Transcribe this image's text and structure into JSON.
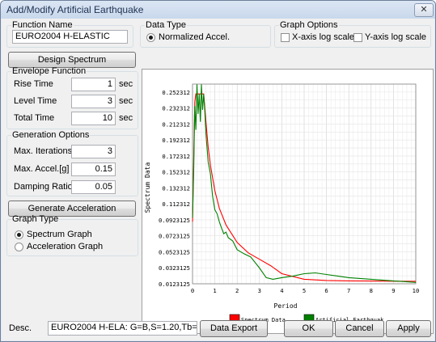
{
  "window": {
    "title": "Add/Modify Artificial Earthquake",
    "close_glyph": "✕"
  },
  "function_name": {
    "label": "Function Name",
    "value": "EURO2004 H-ELASTIC"
  },
  "data_type": {
    "label": "Data Type",
    "option": "Normalized Accel."
  },
  "graph_options": {
    "label": "Graph Options",
    "x_log": "X-axis log scale",
    "y_log": "Y-axis log scale",
    "x_log_checked": false,
    "y_log_checked": false
  },
  "design_spectrum_button": "Design Spectrum",
  "envelope": {
    "label": "Envelope Function",
    "rise_label": "Rise Time",
    "rise_value": "1",
    "rise_unit": "sec",
    "level_label": "Level Time",
    "level_value": "3",
    "level_unit": "sec",
    "total_label": "Total Time",
    "total_value": "10",
    "total_unit": "sec"
  },
  "generation": {
    "label": "Generation Options",
    "iter_label": "Max. Iterations",
    "iter_value": "3",
    "accel_label": "Max. Accel.[g]",
    "accel_value": "0.15",
    "damp_label": "Damping Ratio",
    "damp_value": "0.05"
  },
  "generate_button": "Generate Acceleration",
  "graph_type": {
    "label": "Graph Type",
    "spectrum": "Spectrum Graph",
    "acceleration": "Acceleration Graph",
    "selected": "spectrum"
  },
  "desc": {
    "label": "Desc.",
    "value": "EURO2004 H-ELA: G=B,S=1.20,Tb=0.15,Tc"
  },
  "footer_buttons": {
    "export": "Data Export",
    "ok": "OK",
    "cancel": "Cancel",
    "apply": "Apply"
  },
  "chart_data": {
    "type": "line",
    "xlabel": "Period",
    "ylabel": "Spectrum Data",
    "xlim": [
      0,
      10
    ],
    "ylim": [
      0.0123125,
      0.262312
    ],
    "x_ticks": [
      "0",
      "1",
      "2",
      "3",
      "4",
      "5",
      "6",
      "7",
      "8",
      "9",
      "10"
    ],
    "y_ticks": [
      "0.0123125",
      "0.0323125",
      "0.0523125",
      "0.0723125",
      "0.0923125",
      "0.112312",
      "0.132312",
      "0.152312",
      "0.172312",
      "0.192312",
      "0.212312",
      "0.232312",
      "0.252312"
    ],
    "grid": true,
    "legend_position": "bottom",
    "colors": {
      "spectrum": "#ff0000",
      "artificial": "#008000"
    },
    "series": [
      {
        "name": "Spectrum Data",
        "x": [
          0,
          0.05,
          0.1,
          0.15,
          0.3,
          0.5,
          0.6,
          0.7,
          0.8,
          1.0,
          1.2,
          1.5,
          2.0,
          2.5,
          3.0,
          3.5,
          4.0,
          5.0,
          6.0,
          7.0,
          8.0,
          9.0,
          10.0
        ],
        "y": [
          0.09,
          0.165,
          0.24,
          0.25,
          0.25,
          0.25,
          0.215,
          0.184,
          0.161,
          0.129,
          0.107,
          0.086,
          0.064,
          0.051,
          0.043,
          0.035,
          0.025,
          0.018,
          0.0165,
          0.016,
          0.0158,
          0.0156,
          0.0155
        ]
      },
      {
        "name": "Artificial Earthquak",
        "x": [
          0,
          0.05,
          0.1,
          0.15,
          0.2,
          0.25,
          0.3,
          0.35,
          0.4,
          0.45,
          0.5,
          0.55,
          0.6,
          0.7,
          0.8,
          0.9,
          1.0,
          1.1,
          1.2,
          1.3,
          1.4,
          1.5,
          1.6,
          1.8,
          2.0,
          2.3,
          2.6,
          3.0,
          3.3,
          3.6,
          4.0,
          4.5,
          5.0,
          5.5,
          6.0,
          6.5,
          7.0,
          7.5,
          8.0,
          8.5,
          9.0,
          9.5,
          10.0
        ],
        "y": [
          0.095,
          0.15,
          0.235,
          0.205,
          0.262,
          0.225,
          0.25,
          0.215,
          0.262,
          0.23,
          0.25,
          0.228,
          0.2,
          0.165,
          0.15,
          0.122,
          0.105,
          0.1,
          0.09,
          0.082,
          0.075,
          0.077,
          0.07,
          0.066,
          0.055,
          0.05,
          0.046,
          0.032,
          0.02,
          0.018,
          0.02,
          0.022,
          0.025,
          0.026,
          0.024,
          0.022,
          0.02,
          0.019,
          0.018,
          0.017,
          0.016,
          0.015,
          0.014
        ]
      }
    ]
  }
}
